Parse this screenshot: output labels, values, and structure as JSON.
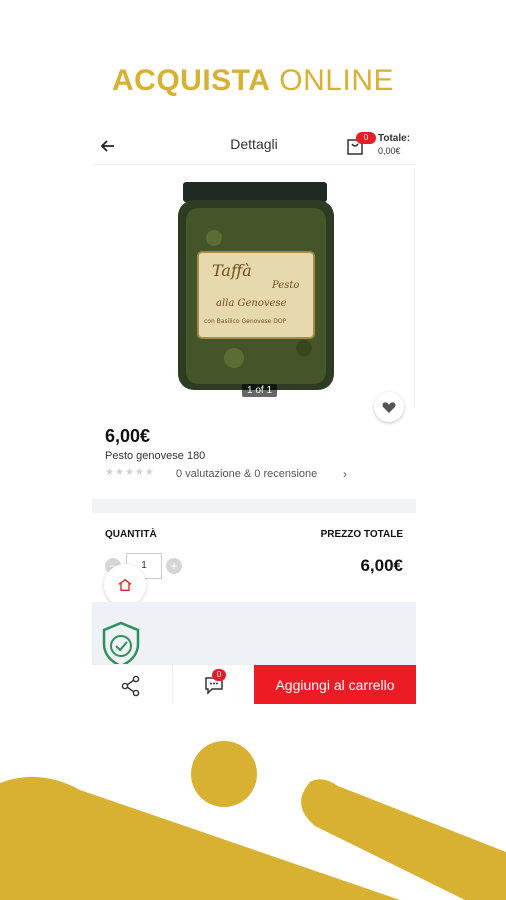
{
  "headline": {
    "strong": "ACQUISTA",
    "light": "ONLINE"
  },
  "appbar": {
    "title": "Dettagli",
    "cart_count": "0",
    "total_label": "Totale:",
    "total_value": "0,00€"
  },
  "gallery": {
    "counter": "1 of 1",
    "jar_brand": "Taffà",
    "jar_line1": "Pesto",
    "jar_line2": "alla Genovese",
    "jar_line3": "con Basilico Genovese DOP"
  },
  "product": {
    "price": "6,00€",
    "name": "Pesto genovese 180",
    "rating_value": 0,
    "rating_max": 5,
    "ratings_text": "0 valutazione & 0 recensione"
  },
  "purchase": {
    "quantity_label": "QUANTITÀ",
    "total_label": "PREZZO TOTALE",
    "quantity_value": "1",
    "total_price": "6,00€"
  },
  "bottombar": {
    "chat_count": "0",
    "add_to_cart": "Aggiungi al carrello"
  },
  "colors": {
    "gold": "#d8b132",
    "red": "#ed1c24",
    "shield_green": "#2f8f5a"
  }
}
